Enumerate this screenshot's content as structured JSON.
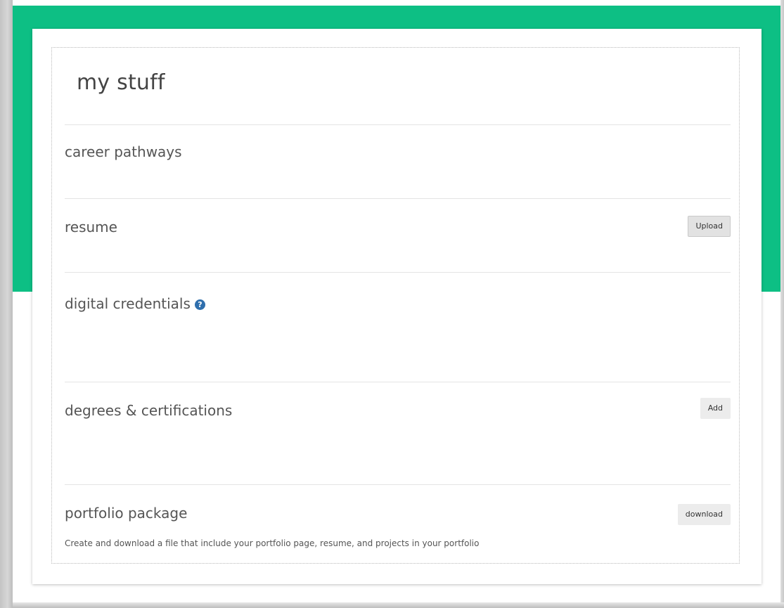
{
  "page": {
    "title": "my stuff"
  },
  "sections": {
    "career_pathways": {
      "title": "career pathways"
    },
    "resume": {
      "title": "resume",
      "button_label": "Upload"
    },
    "digital_credentials": {
      "title": "digital credentials",
      "help_icon": "question-circle-icon",
      "help_glyph": "?"
    },
    "degrees_certifications": {
      "title": "degrees & certifications",
      "button_label": "Add"
    },
    "portfolio_package": {
      "title": "portfolio package",
      "button_label": "download",
      "description": "Create and download a file that include your portfolio page, resume, and projects in your portfolio"
    }
  },
  "colors": {
    "accent_green": "#0dbf84",
    "help_icon_blue": "#2f6fad"
  }
}
